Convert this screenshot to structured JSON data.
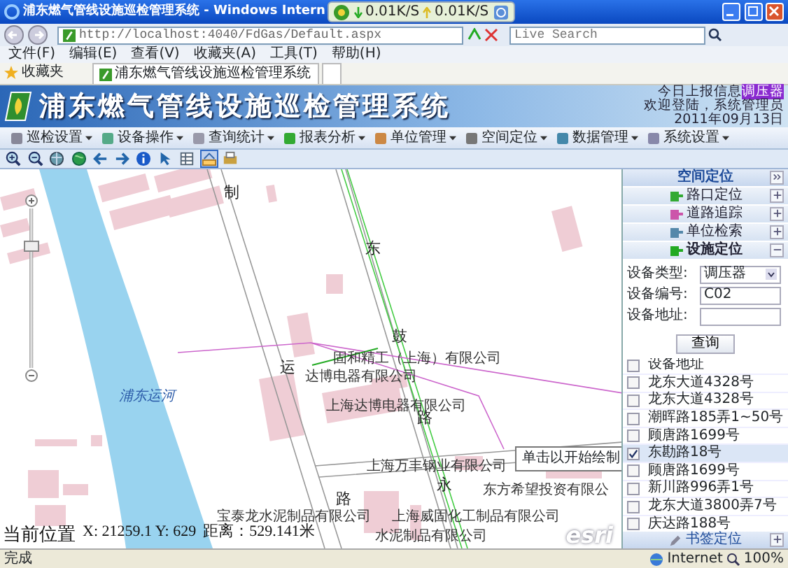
{
  "window": {
    "title": "浦东燃气管线设施巡检管理系统 - Windows Intern"
  },
  "speed_widget": {
    "down": "0.01K/S",
    "up": "0.01K/S"
  },
  "address_bar": {
    "url": "http://localhost:4040/FdGas/Default.aspx",
    "search_placeholder": "Live Search"
  },
  "menu": [
    "文件(F)",
    "编辑(E)",
    "查看(V)",
    "收藏夹(A)",
    "工具(T)",
    "帮助(H)"
  ],
  "favorites": {
    "label": "收藏夹",
    "tab_title": "浦东燃气管线设施巡检管理系统"
  },
  "app": {
    "title": "浦东燃气管线设施巡检管理系统",
    "reports_label": "今日上报信息",
    "reports_value": "调压器",
    "welcome": "欢迎登陆，系统管理员",
    "date": "2011年09月13日",
    "menu": [
      "巡检设置",
      "设备操作",
      "查询统计",
      "报表分析",
      "单位管理",
      "空间定位",
      "数据管理",
      "系统设置"
    ],
    "map_tools": [
      {
        "kind": "zoom-in",
        "selected": false
      },
      {
        "kind": "zoom-out",
        "selected": false
      },
      {
        "kind": "pan",
        "selected": false
      },
      {
        "kind": "full",
        "selected": false
      },
      {
        "kind": "back",
        "selected": false
      },
      {
        "kind": "forward",
        "selected": false
      },
      {
        "kind": "info",
        "selected": false
      },
      {
        "kind": "select",
        "selected": false
      },
      {
        "kind": "table",
        "selected": false
      },
      {
        "kind": "measure",
        "selected": true
      },
      {
        "kind": "print",
        "selected": false
      }
    ]
  },
  "map": {
    "labels": [
      {
        "text": "制",
        "kind": "road"
      },
      {
        "text": "东",
        "kind": "road"
      },
      {
        "text": "鼓",
        "kind": "road"
      },
      {
        "text": "运",
        "kind": "road"
      },
      {
        "text": "固和精工（上海）有限公司",
        "kind": "place"
      },
      {
        "text": "达博电器有限公司",
        "kind": "place"
      },
      {
        "text": "上海达博电器有限公司",
        "kind": "place"
      },
      {
        "text": "路",
        "kind": "road"
      },
      {
        "text": "浦东运河",
        "kind": "water"
      },
      {
        "text": "上海万丰钢业有限公司",
        "kind": "place"
      },
      {
        "text": "永",
        "kind": "road"
      },
      {
        "text": "东方希望投资有限公",
        "kind": "place"
      },
      {
        "text": "上海威固化工制品有限公司",
        "kind": "place"
      },
      {
        "text": "路",
        "kind": "road"
      },
      {
        "text": "宝泰龙水泥制品有限公司",
        "kind": "place"
      },
      {
        "text": "水泥制品有限公司",
        "kind": "place"
      }
    ],
    "tooltip": "单击以开始绘制",
    "position_label": "当前位置",
    "position": "X: 21259.1 Y: 629",
    "distance": "距离：529.141米",
    "logo": "esri",
    "zoom_slider": {
      "level": 0.78
    }
  },
  "panel": {
    "title": "空间定位",
    "sections": [
      {
        "label": "路口定位",
        "expanded": false
      },
      {
        "label": "道路追踪",
        "expanded": false
      },
      {
        "label": "单位检索",
        "expanded": false
      },
      {
        "label": "设施定位",
        "expanded": true
      }
    ],
    "fields": [
      {
        "label": "设备类型:",
        "kind": "select",
        "value": "调压器"
      },
      {
        "label": "设备编号:",
        "kind": "text",
        "value": "C02"
      },
      {
        "label": "设备地址:",
        "kind": "text"
      }
    ],
    "button": "查询",
    "list_header": {
      "text": "设备地址",
      "checked": false
    },
    "rows": [
      {
        "text": "龙东大道4328号",
        "checked": false
      },
      {
        "text": "龙东大道4328号",
        "checked": false
      },
      {
        "text": "潮晖路185弄1~50号",
        "checked": false
      },
      {
        "text": "顾唐路1699号",
        "checked": false
      },
      {
        "text": "东勘路18号",
        "checked": true
      },
      {
        "text": "顾唐路1699号",
        "checked": false
      },
      {
        "text": "新川路996弄1号",
        "checked": false
      },
      {
        "text": "龙东大道3800弄7号",
        "checked": false
      },
      {
        "text": "庆达路188号",
        "checked": false
      }
    ],
    "footer": "书签定位"
  },
  "status_bar": {
    "text": "完成",
    "zone": "Internet",
    "zoom": "100%"
  }
}
